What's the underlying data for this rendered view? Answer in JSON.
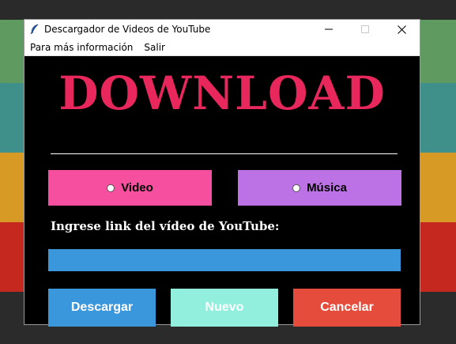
{
  "window": {
    "title": "Descargador de Videos de YouTube",
    "controls": {
      "minimize": "—",
      "maximize": "☐",
      "close": "✕"
    }
  },
  "menu": {
    "items": [
      "Para más información",
      "Salir"
    ]
  },
  "main": {
    "headline": "DOWNLOAD",
    "options": {
      "video_label": "Video",
      "music_label": "Música"
    },
    "prompt": "Ingrese link del vídeo de YouTube:",
    "link_input": {
      "value": "",
      "placeholder": ""
    },
    "buttons": {
      "download": "Descargar",
      "new": "Nuevo",
      "cancel": "Cancelar"
    }
  },
  "colors": {
    "headline": "#e8275c",
    "video_option": "#f74f9f",
    "music_option": "#bc71e5",
    "download_button": "#3b97db",
    "new_button": "#92efde",
    "cancel_button": "#e64c3c",
    "window_background": "#000000"
  },
  "icons": {
    "app": "feather-icon"
  }
}
